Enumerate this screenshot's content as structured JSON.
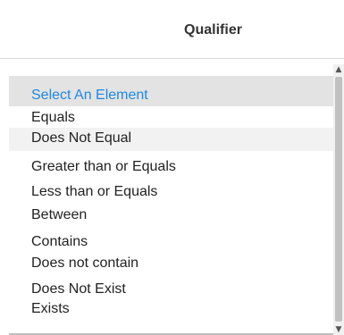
{
  "header": {
    "title": "Qualifier"
  },
  "qualifier_list": {
    "placeholder": "Select An Element",
    "options": [
      "Equals",
      "Does Not Equal",
      "Greater than or Equals",
      "Less than or Equals",
      "Between",
      "Contains",
      "Does not contain",
      "Does Not Exist",
      "Exists"
    ]
  },
  "scrollbar": {
    "up_icon": "chevron-up-icon",
    "down_icon": "chevron-down-icon"
  }
}
